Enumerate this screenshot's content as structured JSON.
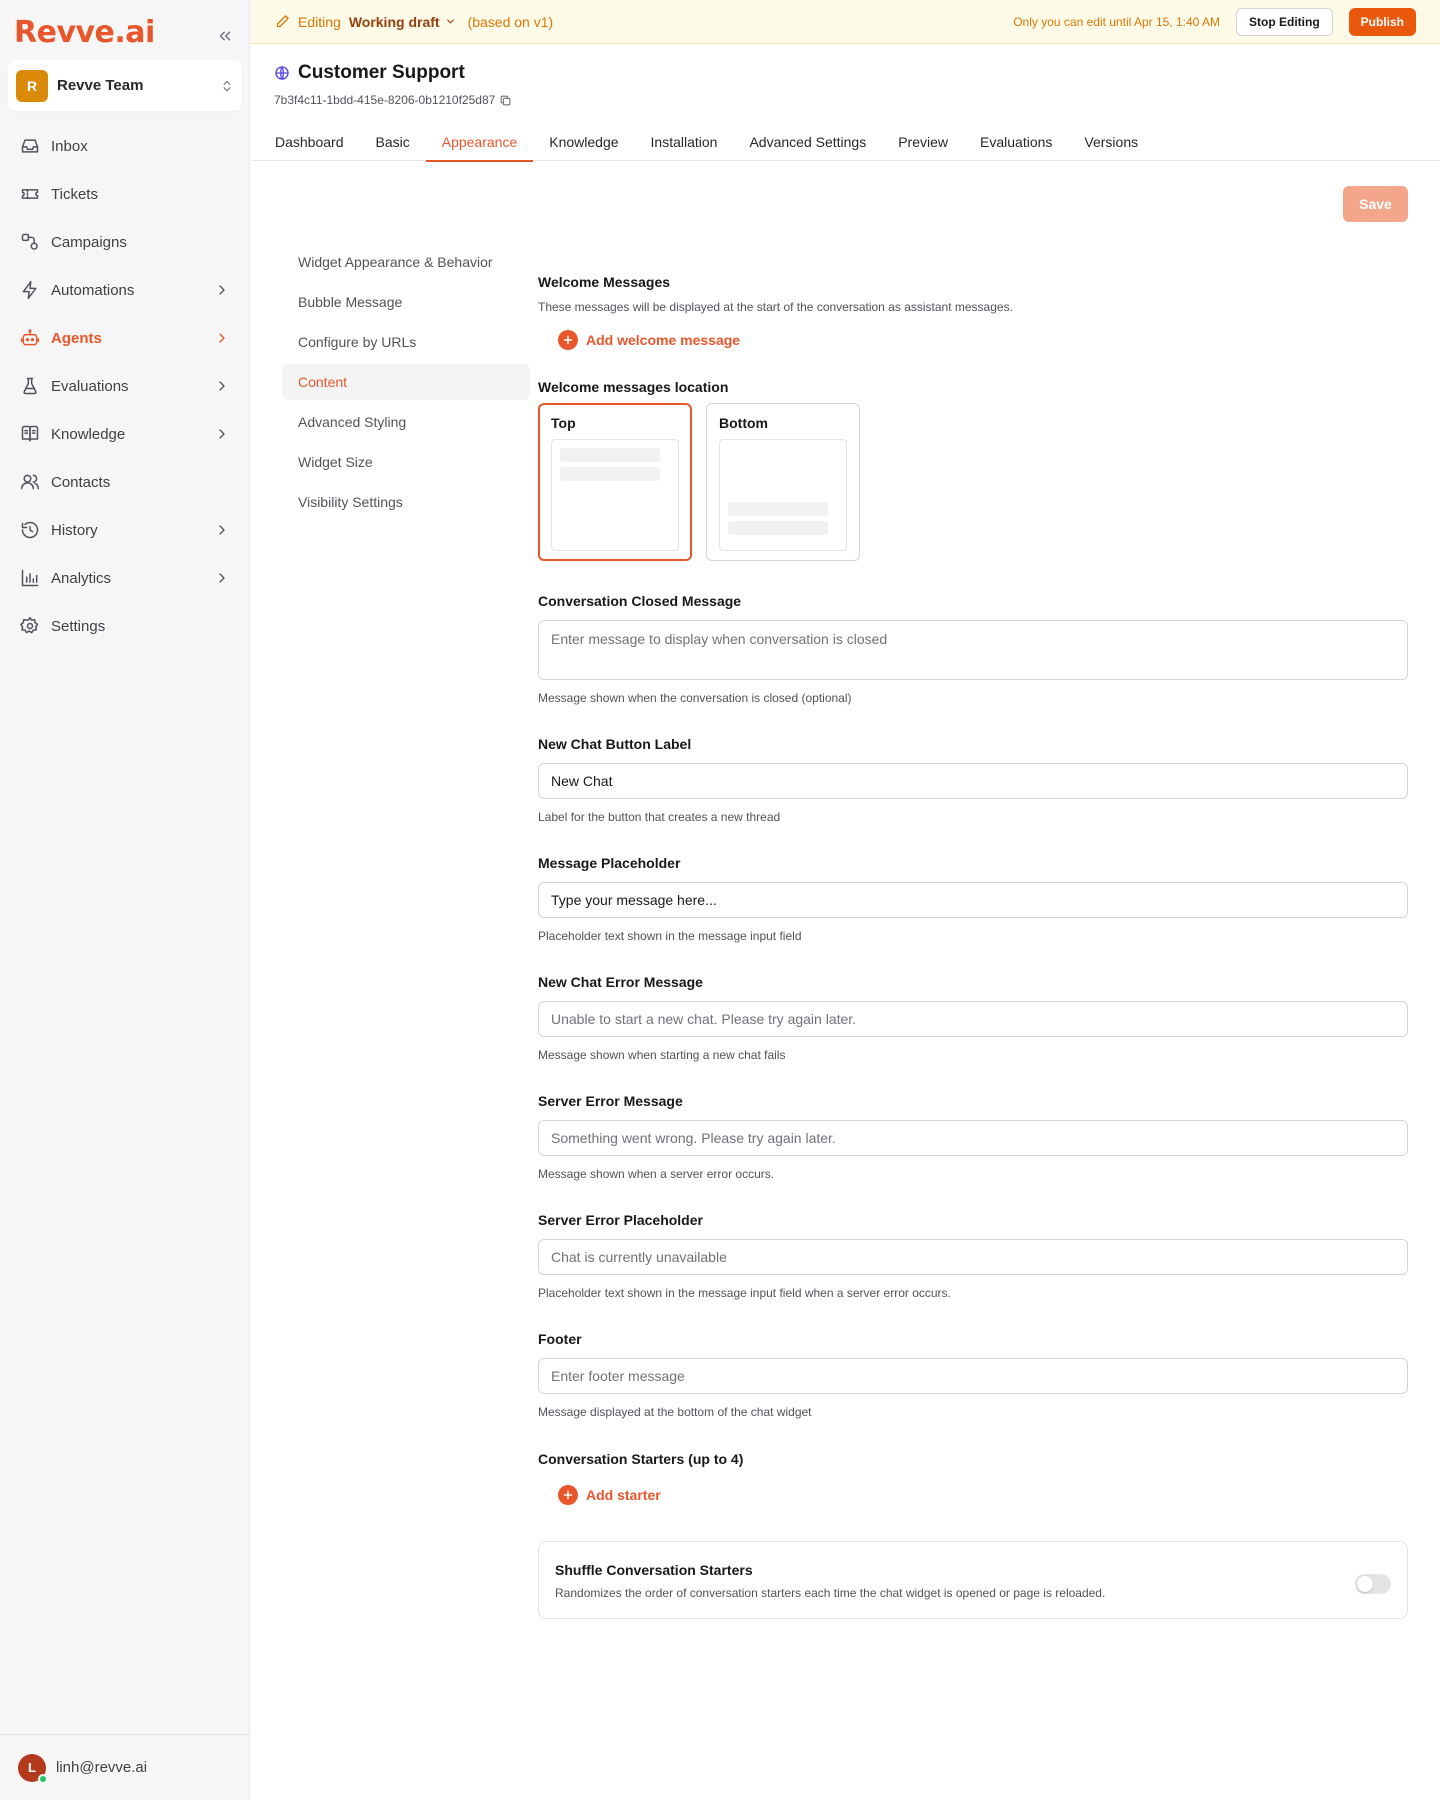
{
  "brand": {
    "logo_text": "Revve.ai",
    "accent": "#e8572c"
  },
  "team": {
    "initial": "R",
    "name": "Revve Team"
  },
  "nav": [
    {
      "id": "inbox",
      "label": "Inbox",
      "icon": "inbox-icon",
      "has_children": false,
      "active": false
    },
    {
      "id": "tickets",
      "label": "Tickets",
      "icon": "ticket-icon",
      "has_children": false,
      "active": false
    },
    {
      "id": "campaigns",
      "label": "Campaigns",
      "icon": "campaigns-icon",
      "has_children": false,
      "active": false
    },
    {
      "id": "automations",
      "label": "Automations",
      "icon": "bolt-icon",
      "has_children": true,
      "active": false
    },
    {
      "id": "agents",
      "label": "Agents",
      "icon": "bot-icon",
      "has_children": true,
      "active": true
    },
    {
      "id": "evaluations",
      "label": "Evaluations",
      "icon": "flask-icon",
      "has_children": true,
      "active": false
    },
    {
      "id": "knowledge",
      "label": "Knowledge",
      "icon": "book-icon",
      "has_children": true,
      "active": false
    },
    {
      "id": "contacts",
      "label": "Contacts",
      "icon": "users-icon",
      "has_children": false,
      "active": false
    },
    {
      "id": "history",
      "label": "History",
      "icon": "history-icon",
      "has_children": true,
      "active": false
    },
    {
      "id": "analytics",
      "label": "Analytics",
      "icon": "chart-icon",
      "has_children": true,
      "active": false
    },
    {
      "id": "settings",
      "label": "Settings",
      "icon": "gear-icon",
      "has_children": false,
      "active": false
    }
  ],
  "user": {
    "initial": "L",
    "email": "linh@revve.ai",
    "status_color": "#22c55e"
  },
  "banner": {
    "editing_label": "Editing",
    "draft_label": "Working draft",
    "based_on": "(based on v1)",
    "lock_text": "Only you can edit until Apr 15, 1:40 AM",
    "stop_label": "Stop Editing",
    "publish_label": "Publish"
  },
  "agent": {
    "title": "Customer Support",
    "id": "7b3f4c11-1bdd-415e-8206-0b1210f25d87"
  },
  "tabs": [
    {
      "label": "Dashboard",
      "active": false
    },
    {
      "label": "Basic",
      "active": false
    },
    {
      "label": "Appearance",
      "active": true
    },
    {
      "label": "Knowledge",
      "active": false
    },
    {
      "label": "Installation",
      "active": false
    },
    {
      "label": "Advanced Settings",
      "active": false
    },
    {
      "label": "Preview",
      "active": false
    },
    {
      "label": "Evaluations",
      "active": false
    },
    {
      "label": "Versions",
      "active": false
    }
  ],
  "save_label": "Save",
  "subnav": [
    {
      "label": "Widget Appearance & Behavior",
      "active": false
    },
    {
      "label": "Bubble Message",
      "active": false
    },
    {
      "label": "Configure by URLs",
      "active": false
    },
    {
      "label": "Content",
      "active": true
    },
    {
      "label": "Advanced Styling",
      "active": false
    },
    {
      "label": "Widget Size",
      "active": false
    },
    {
      "label": "Visibility Settings",
      "active": false
    }
  ],
  "welcome": {
    "title": "Welcome Messages",
    "desc": "These messages will be displayed at the start of the conversation as assistant messages.",
    "add_label": "Add welcome message",
    "location_label": "Welcome messages location",
    "options": [
      {
        "label": "Top",
        "selected": true
      },
      {
        "label": "Bottom",
        "selected": false
      }
    ]
  },
  "fields": {
    "closed": {
      "label": "Conversation Closed Message",
      "placeholder": "Enter message to display when conversation is closed",
      "value": "",
      "help": "Message shown when the conversation is closed (optional)"
    },
    "new_chat": {
      "label": "New Chat Button Label",
      "value": "New Chat",
      "help": "Label for the button that creates a new thread"
    },
    "msg_placeholder": {
      "label": "Message Placeholder",
      "value": "Type your message here...",
      "help": "Placeholder text shown in the message input field"
    },
    "new_chat_error": {
      "label": "New Chat Error Message",
      "placeholder": "Unable to start a new chat. Please try again later.",
      "help": "Message shown when starting a new chat fails"
    },
    "server_error": {
      "label": "Server Error Message",
      "placeholder": "Something went wrong. Please try again later.",
      "help": "Message shown when a server error occurs."
    },
    "server_error_placeholder": {
      "label": "Server Error Placeholder",
      "placeholder": "Chat is currently unavailable",
      "help": "Placeholder text shown in the message input field when a server error occurs."
    },
    "footer": {
      "label": "Footer",
      "placeholder": "Enter footer message",
      "help": "Message displayed at the bottom of the chat widget"
    }
  },
  "starters": {
    "title": "Conversation Starters (up to 4)",
    "add_label": "Add starter"
  },
  "shuffle": {
    "title": "Shuffle Conversation Starters",
    "desc": "Randomizes the order of conversation starters each time the chat widget is opened or page is reloaded.",
    "enabled": false
  }
}
